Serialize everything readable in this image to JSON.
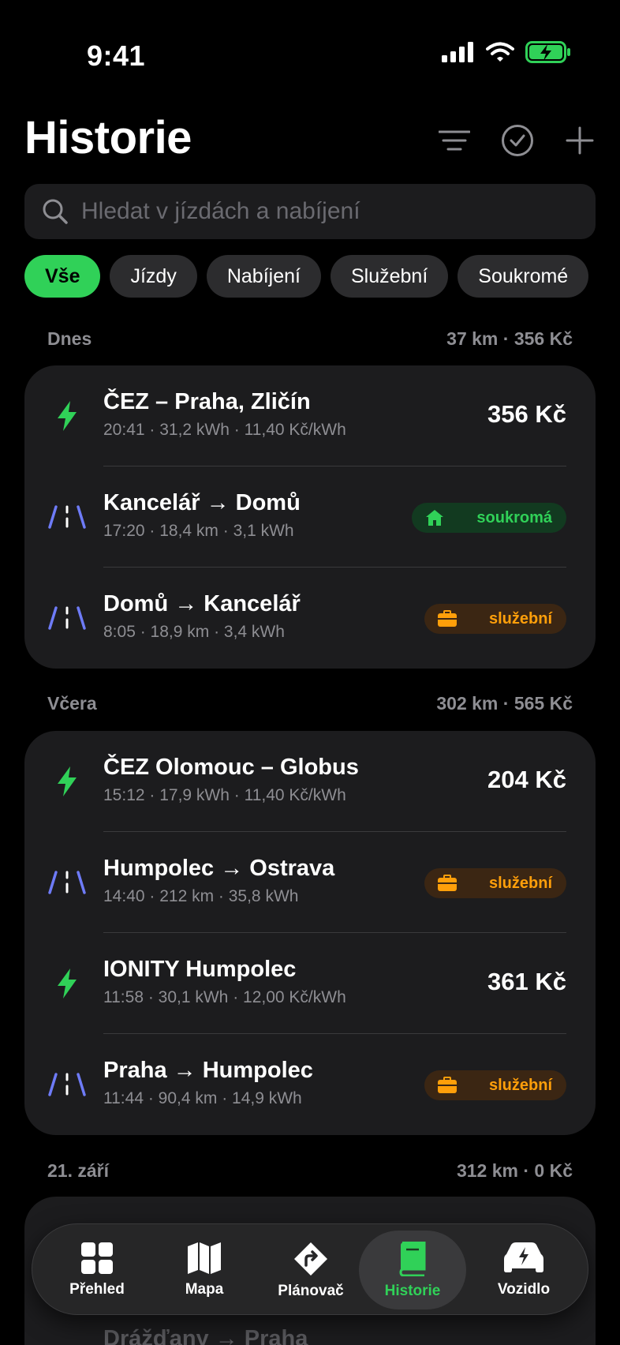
{
  "status_bar": {
    "time": "9:41"
  },
  "header": {
    "title": "Historie"
  },
  "search": {
    "placeholder": "Hledat v jízdách a nabíjení"
  },
  "filters": [
    {
      "label": "Vše",
      "active": true
    },
    {
      "label": "Jízdy",
      "active": false
    },
    {
      "label": "Nabíjení",
      "active": false
    },
    {
      "label": "Služební",
      "active": false
    },
    {
      "label": "Soukromé",
      "active": false
    }
  ],
  "sections": [
    {
      "title": "Dnes",
      "summary": "37 km · 356 Kč",
      "items": [
        {
          "kind": "charge",
          "title": "ČEZ – Praha, Zličín",
          "subtitle": "20:41 · 31,2 kWh · 11,40 Kč/kWh",
          "amount": "356 Kč"
        },
        {
          "kind": "trip",
          "title": "Kancelář → Domů",
          "subtitle": "17:20 · 18,4 km · 3,1 kWh",
          "badge": "soukromá",
          "badge_type": "private"
        },
        {
          "kind": "trip",
          "title": "Domů → Kancelář",
          "subtitle": "8:05 · 18,9 km · 3,4 kWh",
          "badge": "služební",
          "badge_type": "business"
        }
      ]
    },
    {
      "title": "Včera",
      "summary": "302 km · 565 Kč",
      "items": [
        {
          "kind": "charge",
          "title": "ČEZ Olomouc – Globus",
          "subtitle": "15:12 · 17,9 kWh · 11,40 Kč/kWh",
          "amount": "204 Kč"
        },
        {
          "kind": "trip",
          "title": "Humpolec → Ostrava",
          "subtitle": "14:40 · 212 km · 35,8 kWh",
          "badge": "služební",
          "badge_type": "business"
        },
        {
          "kind": "charge",
          "title": "IONITY Humpolec",
          "subtitle": "11:58 · 30,1 kWh · 12,00 Kč/kWh",
          "amount": "361 Kč"
        },
        {
          "kind": "trip",
          "title": "Praha → Humpolec",
          "subtitle": "11:44 · 90,4 km · 14,9 kWh",
          "badge": "služební",
          "badge_type": "business"
        }
      ]
    },
    {
      "title": "21. září",
      "summary": "312 km · 0 Kč",
      "items": [
        {
          "kind": "trip",
          "title": "Drážďany → Praha"
        }
      ]
    }
  ],
  "tabs": [
    {
      "label": "Přehled",
      "icon": "grid-icon",
      "active": false
    },
    {
      "label": "Mapa",
      "icon": "map-icon",
      "active": false
    },
    {
      "label": "Plánovač",
      "icon": "route-icon",
      "active": false
    },
    {
      "label": "Historie",
      "icon": "book-icon",
      "active": true
    },
    {
      "label": "Vozidlo",
      "icon": "car-icon",
      "active": false
    }
  ],
  "colors": {
    "accent": "#30d158",
    "business": "#ff9f0a",
    "trip": "#6e7bf7",
    "background": "#000000",
    "card": "#1c1c1e"
  }
}
